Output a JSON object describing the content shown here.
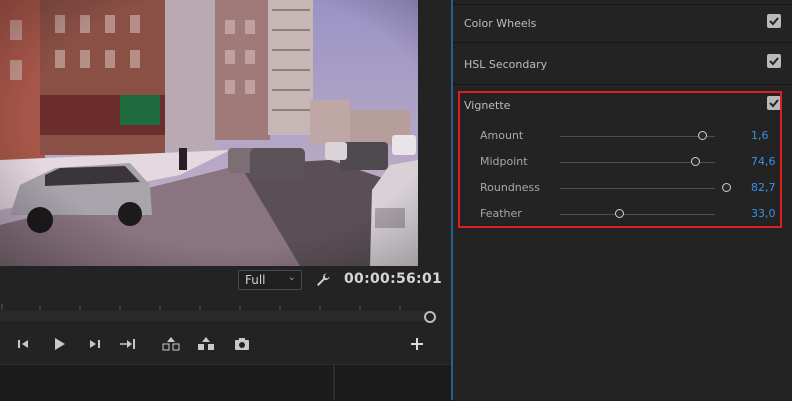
{
  "monitor": {
    "zoom_level": "Full",
    "timecode": "00:00:56:01",
    "playhead_position_fraction": 1.0
  },
  "transport": {
    "icons": [
      "step-back-icon",
      "play-icon",
      "step-forward-icon",
      "go-to-out-icon",
      "lift-icon",
      "extract-icon",
      "camera-icon",
      "add-icon"
    ]
  },
  "lumetri": {
    "sections": [
      {
        "title": "Color Wheels",
        "checked": true
      },
      {
        "title": "HSL Secondary",
        "checked": true
      }
    ],
    "vignette": {
      "title": "Vignette",
      "checked": true,
      "params": [
        {
          "label": "Amount",
          "value": "1,6",
          "slider_fraction": 0.92
        },
        {
          "label": "Midpoint",
          "value": "74,6",
          "slider_fraction": 0.88
        },
        {
          "label": "Roundness",
          "value": "82,7",
          "slider_fraction": 1.08
        },
        {
          "label": "Feather",
          "value": "33,0",
          "slider_fraction": 0.39
        }
      ]
    }
  },
  "colors": {
    "highlight_border": "#e01e1e",
    "value_blue": "#3b8fe6",
    "panel_split": "#2f5d8a"
  }
}
